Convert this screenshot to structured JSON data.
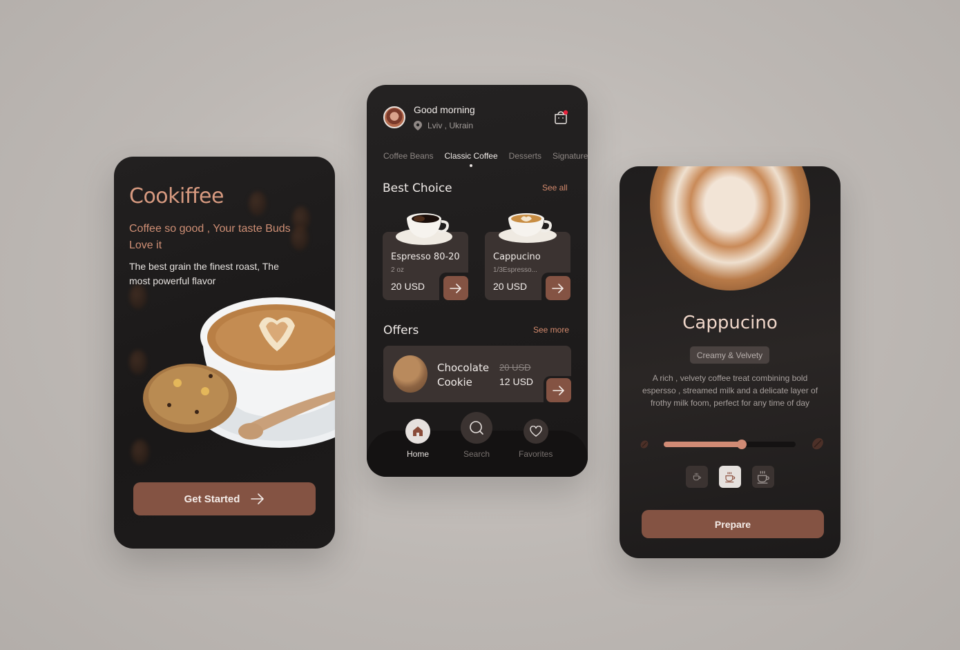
{
  "onboarding": {
    "brand": "Cookiffee",
    "tagline": "Coffee so good , Your taste Buds Love it",
    "description": "The best grain the finest roast, The most powerful flavor",
    "cta_label": "Get Started",
    "cta_icon": "arrow-right-icon"
  },
  "home": {
    "greeting": "Good morning",
    "location": "Lviv , Ukrain",
    "location_icon": "map-pin-icon",
    "cart_icon": "shopping-bag-icon",
    "cart_has_notification": true,
    "tabs": [
      {
        "label": "Coffee Beans",
        "active": false
      },
      {
        "label": "Classic Coffee",
        "active": true
      },
      {
        "label": "Desserts",
        "active": false
      },
      {
        "label": "Signature",
        "active": false
      }
    ],
    "best_choice": {
      "title": "Best Choice",
      "link": "See all",
      "items": [
        {
          "name": "Espresso 80-20",
          "subtitle": "2 oz",
          "price": "20 USD"
        },
        {
          "name": "Cappucino",
          "subtitle": "1/3Espresso...",
          "price": "20 USD"
        }
      ]
    },
    "offers": {
      "title": "Offers",
      "link": "See more",
      "item": {
        "name": "Chocolate Cookie",
        "old_price": "20 USD",
        "new_price": "12 USD"
      }
    },
    "nav": [
      {
        "label": "Home",
        "icon": "home-icon",
        "active": true
      },
      {
        "label": "Search",
        "icon": "search-icon",
        "active": false
      },
      {
        "label": "Favorites",
        "icon": "heart-icon",
        "active": false
      }
    ]
  },
  "detail": {
    "title": "Cappucino",
    "chip": "Creamy & Velvety",
    "description": "A rich , velvety coffee treat combining bold espersso , streamed milk and a delicate layer of frothy milk foom, perfect for any time of day",
    "strength_percent": 59,
    "sizes": [
      {
        "name": "small",
        "active": false
      },
      {
        "name": "medium",
        "active": true
      },
      {
        "name": "large",
        "active": false
      }
    ],
    "cta_label": "Prepare",
    "colors": {
      "accent": "#845343",
      "highlight": "#d18b75"
    }
  }
}
